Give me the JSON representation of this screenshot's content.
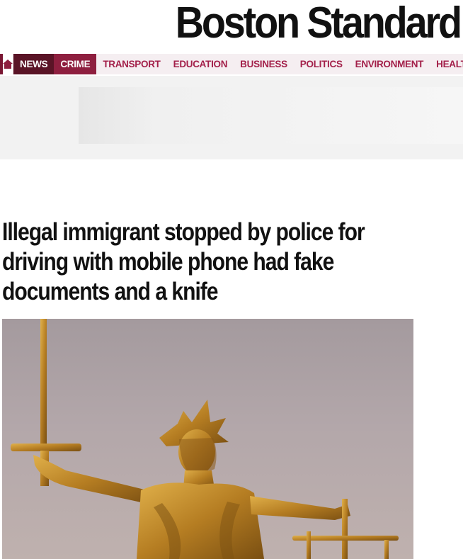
{
  "masthead": {
    "logo_text": "Boston Standard"
  },
  "nav": {
    "home_icon": "home-icon",
    "items": [
      {
        "label": "NEWS",
        "state": "parent"
      },
      {
        "label": "CRIME",
        "state": "active"
      },
      {
        "label": "TRANSPORT"
      },
      {
        "label": "EDUCATION"
      },
      {
        "label": "BUSINESS"
      },
      {
        "label": "POLITICS"
      },
      {
        "label": "ENVIRONMENT"
      },
      {
        "label": "HEALTH"
      }
    ]
  },
  "article": {
    "headline": "Illegal immigrant stopped by police for driving with mobile phone had fake documents and a knife"
  },
  "colors": {
    "brand": "#7a1733",
    "nav_parent": "#5a1426",
    "nav_active": "#8e1f3f",
    "nav_text": "#a3204a",
    "statue_gold": "#c08b2c"
  }
}
